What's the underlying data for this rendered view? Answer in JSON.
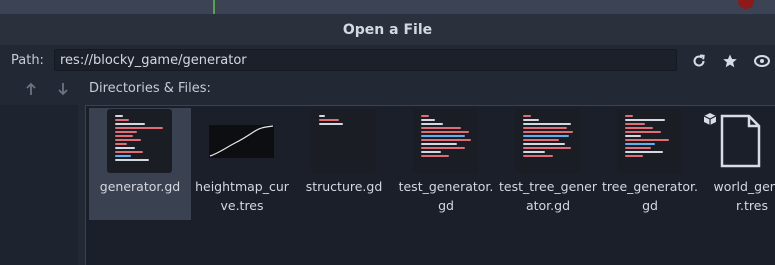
{
  "window": {
    "title": "Open a File"
  },
  "path": {
    "label": "Path:",
    "value": "res://blocky_game/generator"
  },
  "toolbar": {
    "refresh_icon": "refresh-icon",
    "favorite_icon": "star-icon",
    "toggle_hidden_icon": "eye-icon"
  },
  "navigation": {
    "up_icon": "arrow-up-icon",
    "down_icon": "arrow-down-icon"
  },
  "files_section": {
    "label": "Directories & Files:"
  },
  "files": [
    {
      "name": "generator.gd",
      "type": "script",
      "selected": true
    },
    {
      "name": "heightmap_cur\nve.tres",
      "type": "curve"
    },
    {
      "name": "structure.gd",
      "type": "script"
    },
    {
      "name": "test_generator.\ngd",
      "type": "script"
    },
    {
      "name": "test_tree_gener\nator.gd",
      "type": "script"
    },
    {
      "name": "tree_generator.\ngd",
      "type": "script"
    },
    {
      "name": "world_gener\nr.tres",
      "type": "resource"
    }
  ],
  "colors": {
    "background": "#232835",
    "selected": "#3a4150",
    "accent": "#d8dce4"
  }
}
